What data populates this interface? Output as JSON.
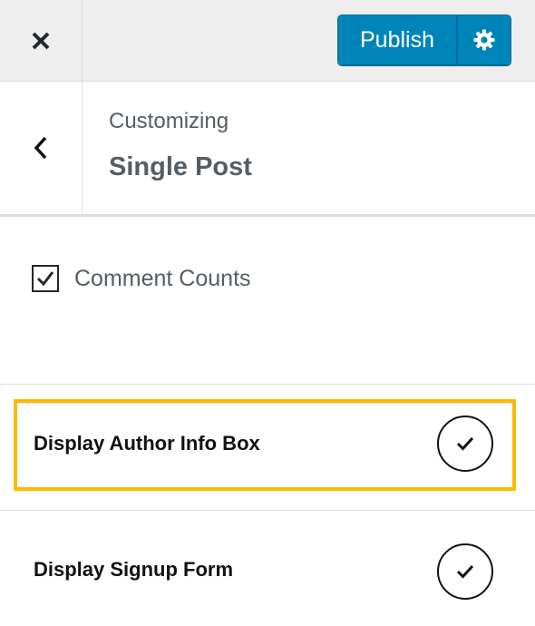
{
  "topbar": {
    "close_icon": "close-icon",
    "publish_label": "Publish",
    "settings_icon": "gear-icon",
    "accent_color": "#0085ba"
  },
  "section": {
    "back_icon": "chevron-left-icon",
    "eyebrow": "Customizing",
    "title": "Single Post"
  },
  "options": {
    "comment_counts": {
      "label": "Comment Counts",
      "checked": true
    },
    "author_info_box": {
      "label": "Display Author Info Box",
      "enabled": true,
      "highlight_color": "#ffb900"
    },
    "signup_form": {
      "label": "Display Signup Form",
      "enabled": true
    }
  }
}
